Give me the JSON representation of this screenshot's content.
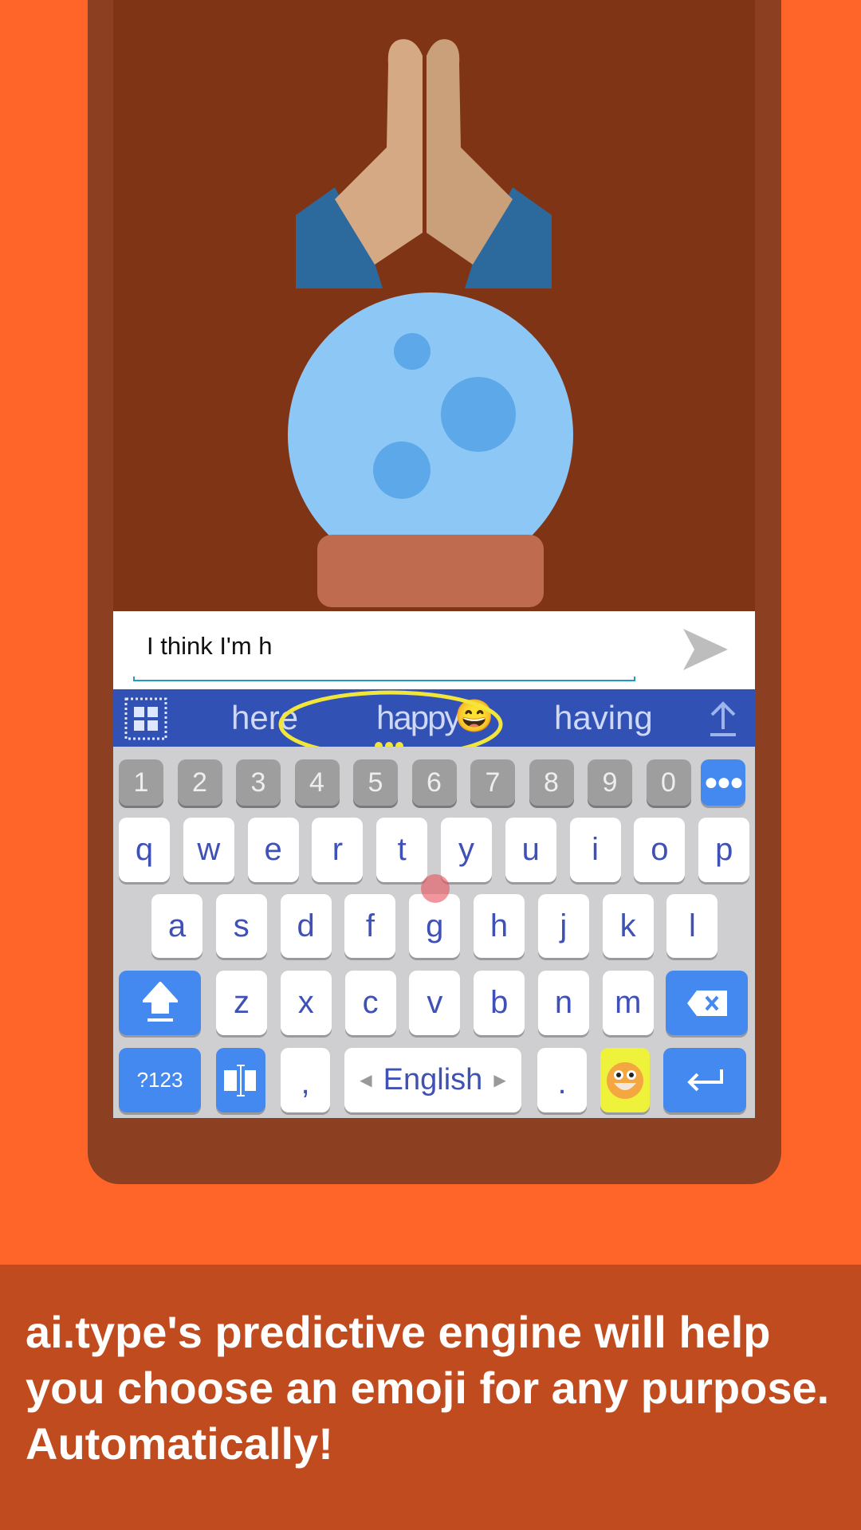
{
  "input": {
    "text": "I think I'm h"
  },
  "suggestions": [
    "here",
    "happy",
    "having"
  ],
  "suggestion_emoji": "😄",
  "number_row": [
    "1",
    "2",
    "3",
    "4",
    "5",
    "6",
    "7",
    "8",
    "9",
    "0"
  ],
  "rows": [
    [
      "q",
      "w",
      "e",
      "r",
      "t",
      "y",
      "u",
      "i",
      "o",
      "p"
    ],
    [
      "a",
      "s",
      "d",
      "f",
      "g",
      "h",
      "j",
      "k",
      "l"
    ],
    [
      "z",
      "x",
      "c",
      "v",
      "b",
      "n",
      "m"
    ]
  ],
  "bottom": {
    "symbols": "?123",
    "comma": ",",
    "space": "English",
    "period": "."
  },
  "banner": {
    "text": "ai.type's predictive engine will help you choose an emoji for any purpose. Automatically!"
  },
  "colors": {
    "background": "#FF6529",
    "suggestion_bar": "#3151B5",
    "accent_key": "#4489F0",
    "banner": "#C04B1E"
  }
}
